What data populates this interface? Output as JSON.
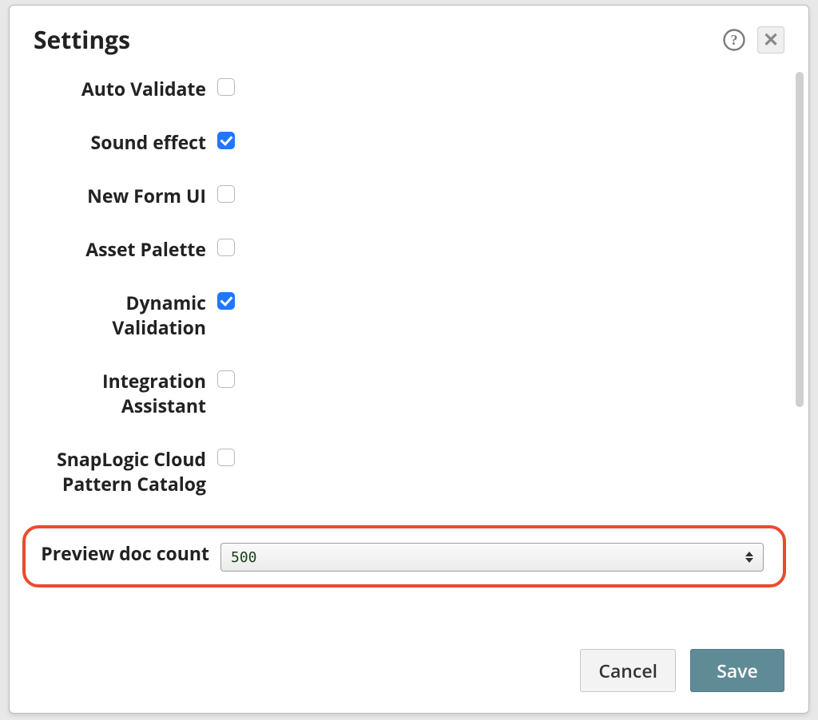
{
  "dialog": {
    "title": "Settings",
    "fields": {
      "auto_validate": {
        "label": "Auto Validate",
        "checked": false
      },
      "sound_effect": {
        "label": "Sound effect",
        "checked": true
      },
      "new_form_ui": {
        "label": "New Form UI",
        "checked": false
      },
      "asset_palette": {
        "label": "Asset Palette",
        "checked": false
      },
      "dynamic_validation": {
        "label": "Dynamic Validation",
        "checked": true
      },
      "integration_assistant": {
        "label": "Integration Assistant",
        "checked": false
      },
      "snaplogic_catalog": {
        "label": "SnapLogic Cloud Pattern Catalog",
        "checked": false
      },
      "preview_doc_count": {
        "label": "Preview doc count",
        "value": "500"
      }
    },
    "buttons": {
      "cancel": "Cancel",
      "save": "Save"
    }
  }
}
